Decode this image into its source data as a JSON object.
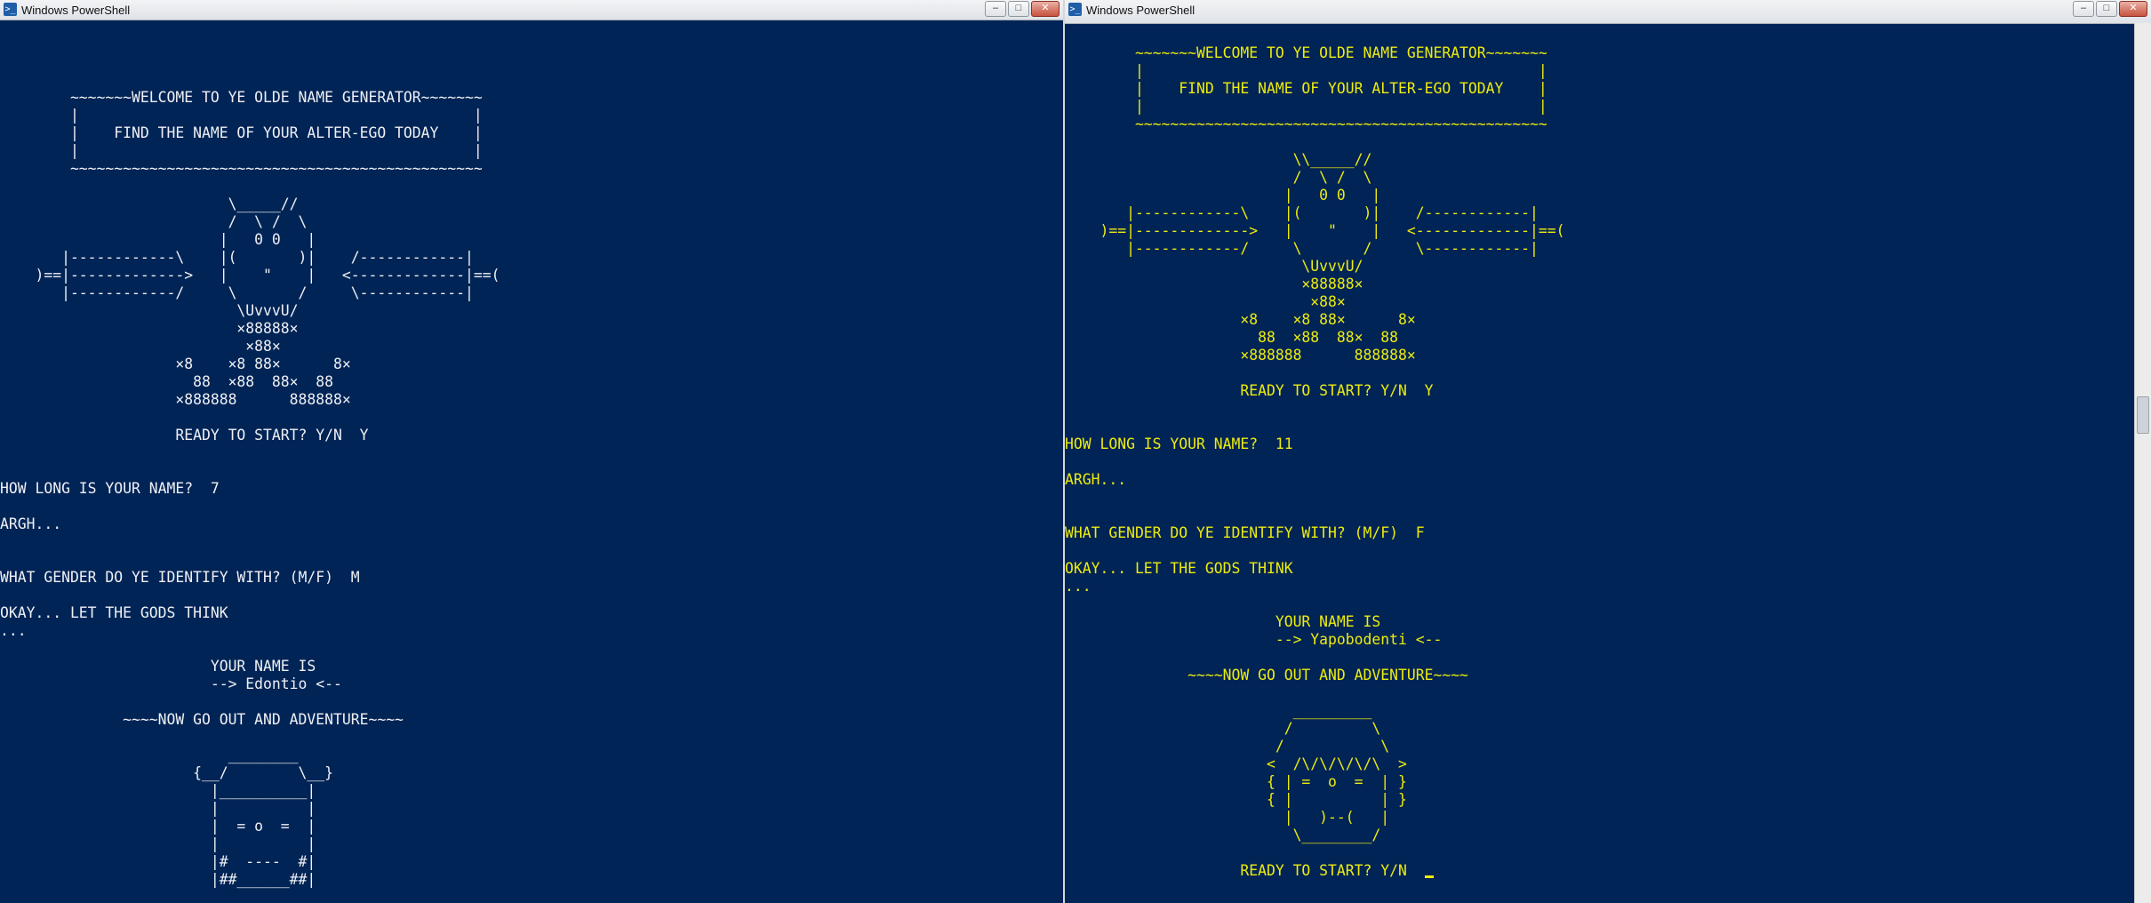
{
  "left_window": {
    "title": "Windows PowerShell",
    "controls": {
      "minimize": "–",
      "maximize": "□",
      "close": "✕"
    },
    "console_text": "        ~~~~~~~WELCOME TO YE OLDE NAME GENERATOR~~~~~~~\n        |                                             |\n        |    FIND THE NAME OF YOUR ALTER-EGO TODAY    |\n        |                                             |\n        ~~~~~~~~~~~~~~~~~~~~~~~~~~~~~~~~~~~~~~~~~~~~~~~\n\n                          \\_____//\n                          /  \\ /  \\\n                         |   0 0   |\n       |------------\\    |(       )|    /------------|\n    )==|------------->   |    \"    |   <-------------|==(\n       |------------/     \\       /     \\------------|\n                           \\UvvvU/\n                           ×88888×\n                            ×88×\n                    ×8    ×8 88×      8×\n                      88  ×88  88×  88\n                    ×888888      888888×\n\n                    READY TO START? Y/N  Y\n\n\nHOW LONG IS YOUR NAME?  7\n\nARGH...\n\n\nWHAT GENDER DO YE IDENTIFY WITH? (M/F)  M\n\nOKAY... LET THE GODS THINK\n...\n\n                        YOUR NAME IS\n                        --> Edontio <--\n\n              ~~~~NOW GO OUT AND ADVENTURE~~~~\n\n                          ________\n                      {__/        \\__}\n                        |__________|\n                        |          |\n                        |  = o  =  |\n                        |          |\n                        |#  ----  #|\n                        |##______##|"
  },
  "right_window": {
    "title": "Windows PowerShell",
    "controls": {
      "minimize": "–",
      "maximize": "□",
      "close": "✕"
    },
    "console_text": "        ~~~~~~~WELCOME TO YE OLDE NAME GENERATOR~~~~~~~\n        |                                             |\n        |    FIND THE NAME OF YOUR ALTER-EGO TODAY    |\n        |                                             |\n        ~~~~~~~~~~~~~~~~~~~~~~~~~~~~~~~~~~~~~~~~~~~~~~~\n\n                          \\\\_____//\n                          /  \\ /  \\\n                         |   0 0   |\n       |------------\\    |(       )|    /------------|\n    )==|------------->   |    \"    |   <-------------|==(\n       |------------/     \\       /     \\------------|\n                           \\UvvvU/\n                           ×88888×\n                            ×88×\n                    ×8    ×8 88×      8×\n                      88  ×88  88×  88\n                    ×888888      888888×\n\n                    READY TO START? Y/N  Y\n\n\nHOW LONG IS YOUR NAME?  11\n\nARGH...\n\n\nWHAT GENDER DO YE IDENTIFY WITH? (M/F)  F\n\nOKAY... LET THE GODS THINK\n...\n\n                        YOUR NAME IS\n                        --> Yapobodenti <--\n\n              ~~~~NOW GO OUT AND ADVENTURE~~~~\n\n                          _________\n                         /         \\\n                        /           \\\n                       <  /\\/\\/\\/\\/\\  >\n                       { | =  o  =  | }\n                       { |          | }\n                         |   )--(   |\n                          \\________/\n\n                    READY TO START? Y/N  "
  }
}
